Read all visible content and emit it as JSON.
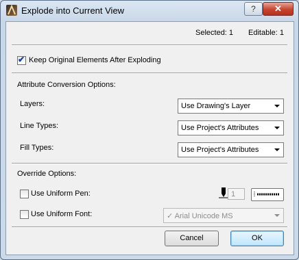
{
  "window": {
    "title": "Explode into Current View",
    "help_label": "?",
    "close_label": "✕"
  },
  "status": {
    "selected": "Selected: 1",
    "editable": "Editable: 1"
  },
  "keep_original": {
    "label": "Keep Original Elements After Exploding",
    "checked": true,
    "check_glyph": "✔"
  },
  "attribute_section": {
    "heading": "Attribute Conversion Options:",
    "layers_label": "Layers:",
    "layers_value": "Use Drawing's Layer",
    "line_types_label": "Line Types:",
    "line_types_value": "Use Project's Attributes",
    "fill_types_label": "Fill Types:",
    "fill_types_value": "Use Project's Attributes"
  },
  "override_section": {
    "heading": "Override  Options:",
    "uniform_pen_label": "Use Uniform Pen:",
    "uniform_pen_checked": false,
    "pen_value": "1",
    "uniform_font_label": "Use Uniform Font:",
    "uniform_font_checked": false,
    "font_value": "Arial Unicode MS",
    "font_check_glyph": "✓"
  },
  "buttons": {
    "cancel": "Cancel",
    "ok": "OK"
  },
  "icons": {
    "app": "archicad-app-icon",
    "pen": "pen-icon",
    "line-pattern": "line-pattern-swatch"
  }
}
